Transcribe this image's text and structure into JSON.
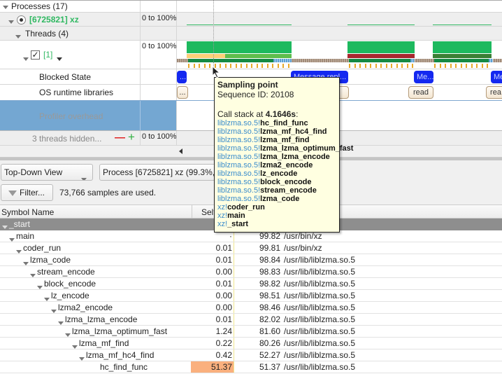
{
  "timeline": {
    "processes_header": "Processes (17)",
    "process": {
      "label": "[6725821] xz",
      "range": "0 to 100%"
    },
    "threads_header": "Threads (4)",
    "thread": {
      "label": "[1]",
      "range": "0 to 100%",
      "checked": true
    },
    "blocked_state_label": "Blocked State",
    "os_runtime_label": "OS runtime libraries",
    "profiler_overhead_label": "Profiler overhead",
    "hidden_threads": {
      "label": "3 threads hidden...",
      "minus": "—",
      "plus": "+",
      "range": "0 to 100%"
    },
    "blocked_events": [
      "...",
      "Message repl...",
      "Me...",
      "Me..."
    ],
    "os_events": [
      "...",
      "",
      "read",
      "rea"
    ],
    "colors": {
      "process_green": "#2fb861",
      "cpu_green": "#1db95e",
      "blocked_blue": "#1428f0",
      "selected_row": "#74a7d2",
      "red_band": "#a8282e",
      "dark_green_band": "#3a7f34",
      "yellow_band": "#fbcf78",
      "light_green_band": "#5ebd4c",
      "tick_orange": "#e8a92a"
    }
  },
  "tooltip": {
    "title": "Sampling point",
    "sequence": "Sequence ID: 20108",
    "call_stack_prefix": "Call stack at ",
    "call_stack_time": "4.1646s",
    "call_stack_suffix": ":",
    "frames": [
      {
        "lib": "liblzma.so.5!",
        "fn": "hc_find_func"
      },
      {
        "lib": "liblzma.so.5!",
        "fn": "lzma_mf_hc4_find"
      },
      {
        "lib": "liblzma.so.5!",
        "fn": "lzma_mf_find"
      },
      {
        "lib": "liblzma.so.5!",
        "fn": "lzma_lzma_optimum_fast"
      },
      {
        "lib": "liblzma.so.5!",
        "fn": "lzma_lzma_encode"
      },
      {
        "lib": "liblzma.so.5!",
        "fn": "lzma2_encode"
      },
      {
        "lib": "liblzma.so.5!",
        "fn": "lz_encode"
      },
      {
        "lib": "liblzma.so.5!",
        "fn": "block_encode"
      },
      {
        "lib": "liblzma.so.5!",
        "fn": "stream_encode"
      },
      {
        "lib": "liblzma.so.5!",
        "fn": "lzma_code"
      },
      {
        "lib": "xz!",
        "fn": "coder_run"
      },
      {
        "lib": "xz!",
        "fn": "main"
      },
      {
        "lib": "xz!",
        "fn": "_start"
      }
    ]
  },
  "toolbar": {
    "view_select": "Top-Down View",
    "process_select": "Process [6725821] xz (99.3%, ...",
    "filter_button": "Filter...",
    "samples_text": "73,766 samples are used."
  },
  "table": {
    "headers": {
      "symbol": "Symbol Name",
      "self": "Self",
      "total": "",
      "module": ""
    },
    "selected_row": "_start",
    "rows": [
      {
        "name": "main",
        "depth": 1,
        "expanded": true,
        "self": "·",
        "total": "99.82",
        "total_pct": 99.82,
        "module": "/usr/bin/xz"
      },
      {
        "name": "coder_run",
        "depth": 2,
        "expanded": true,
        "self": "0.01",
        "total": "99.81",
        "total_pct": 99.81,
        "module": "/usr/bin/xz"
      },
      {
        "name": "lzma_code",
        "depth": 3,
        "expanded": true,
        "self": "0.01",
        "total": "98.84",
        "total_pct": 98.84,
        "module": "/usr/lib/liblzma.so.5"
      },
      {
        "name": "stream_encode",
        "depth": 4,
        "expanded": true,
        "self": "0.00",
        "total": "98.83",
        "total_pct": 98.83,
        "module": "/usr/lib/liblzma.so.5"
      },
      {
        "name": "block_encode",
        "depth": 5,
        "expanded": true,
        "self": "0.01",
        "total": "98.82",
        "total_pct": 98.82,
        "module": "/usr/lib/liblzma.so.5"
      },
      {
        "name": "lz_encode",
        "depth": 6,
        "expanded": true,
        "self": "0.00",
        "total": "98.51",
        "total_pct": 98.51,
        "module": "/usr/lib/liblzma.so.5"
      },
      {
        "name": "lzma2_encode",
        "depth": 7,
        "expanded": true,
        "self": "0.00",
        "total": "98.46",
        "total_pct": 98.46,
        "module": "/usr/lib/liblzma.so.5"
      },
      {
        "name": "lzma_lzma_encode",
        "depth": 8,
        "expanded": true,
        "self": "0.01",
        "total": "82.02",
        "total_pct": 82.02,
        "module": "/usr/lib/liblzma.so.5"
      },
      {
        "name": "lzma_lzma_optimum_fast",
        "depth": 9,
        "expanded": true,
        "self": "1.24",
        "total": "81.60",
        "total_pct": 81.6,
        "module": "/usr/lib/liblzma.so.5"
      },
      {
        "name": "lzma_mf_find",
        "depth": 10,
        "expanded": true,
        "self": "0.22",
        "total": "80.26",
        "total_pct": 80.26,
        "module": "/usr/lib/liblzma.so.5"
      },
      {
        "name": "lzma_mf_hc4_find",
        "depth": 11,
        "expanded": true,
        "self": "0.42",
        "total": "52.27",
        "total_pct": 52.27,
        "module": "/usr/lib/liblzma.so.5"
      },
      {
        "name": "hc_find_func",
        "depth": 12,
        "expanded": false,
        "self": "51.37",
        "self_pct": 51.37,
        "total": "51.37",
        "total_pct": 51.37,
        "module": "/usr/lib/liblzma.so.5"
      }
    ]
  }
}
